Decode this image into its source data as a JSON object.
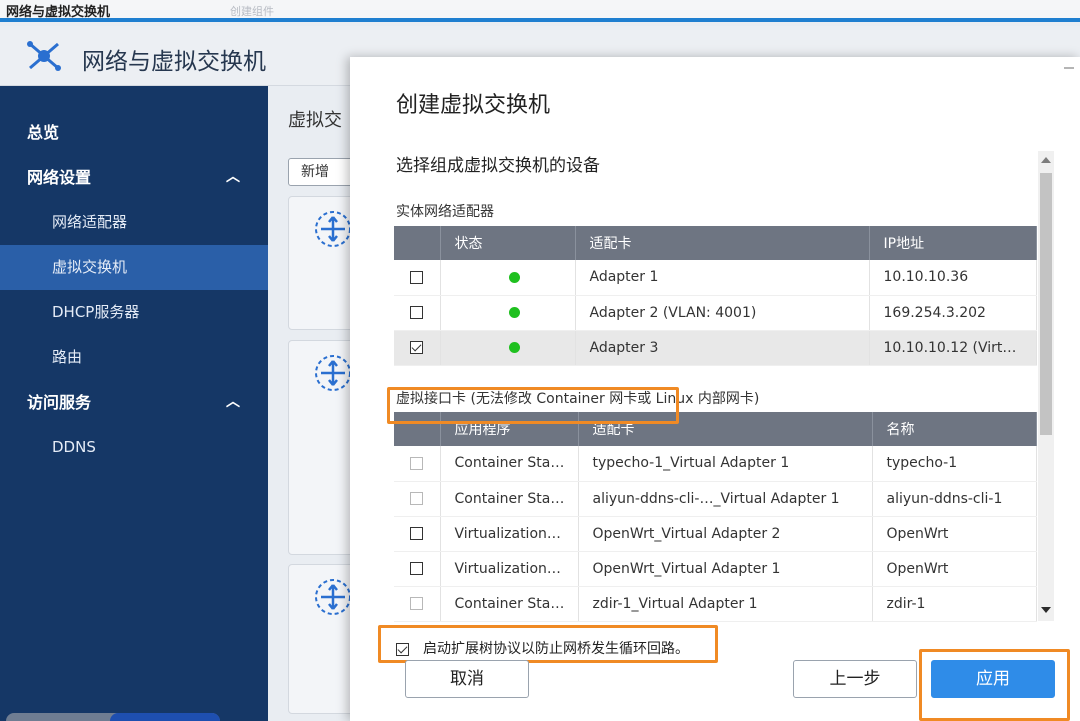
{
  "window": {
    "title": "网络与虚拟交换机",
    "faded_tab": "创建组件"
  },
  "app": {
    "title": "网络与虚拟交换机",
    "logo_icon": "network-switch-icon"
  },
  "sidebar": {
    "items": [
      {
        "label": "总览",
        "type": "top"
      },
      {
        "label": "网络设置",
        "type": "top",
        "chevron": "^"
      },
      {
        "label": "网络适配器",
        "type": "sub"
      },
      {
        "label": "虚拟交换机",
        "type": "sub",
        "active": true
      },
      {
        "label": "DHCP服务器",
        "type": "sub"
      },
      {
        "label": "路由",
        "type": "sub"
      },
      {
        "label": "访问服务",
        "type": "top",
        "chevron": "^"
      },
      {
        "label": "DDNS",
        "type": "sub"
      }
    ]
  },
  "main": {
    "heading": "虚拟交",
    "new_button": "新增"
  },
  "modal": {
    "title": "创建虚拟交换机",
    "section_title": "选择组成虚拟交换机的设备",
    "physical": {
      "label": "实体网络适配器",
      "headers": [
        "",
        "状态",
        "适配卡",
        "IP地址"
      ],
      "rows": [
        {
          "checked": false,
          "status": "green",
          "adapter": "Adapter 1",
          "ip": "10.10.10.36"
        },
        {
          "checked": false,
          "status": "green",
          "adapter": "Adapter 2 (VLAN: 4001)",
          "ip": "169.254.3.202"
        },
        {
          "checked": true,
          "status": "green",
          "adapter": "Adapter 3",
          "ip": "10.10.10.12 (Virt…"
        }
      ]
    },
    "virtual": {
      "label": "虚拟接口卡 (无法修改 Container 网卡或 Linux 内部网卡)",
      "headers": [
        "",
        "应用程序",
        "适配卡",
        "名称"
      ],
      "rows": [
        {
          "disabled": true,
          "app": "Container Sta…",
          "adapter": "typecho-1_Virtual Adapter 1",
          "name": "typecho-1"
        },
        {
          "disabled": true,
          "app": "Container Sta…",
          "adapter": "aliyun-ddns-cli-…_Virtual Adapter 1",
          "name": "aliyun-ddns-cli-1"
        },
        {
          "disabled": false,
          "app": "Virtualization…",
          "adapter": "OpenWrt_Virtual Adapter 2",
          "name": "OpenWrt"
        },
        {
          "disabled": false,
          "app": "Virtualization…",
          "adapter": "OpenWrt_Virtual Adapter 1",
          "name": "OpenWrt"
        },
        {
          "disabled": true,
          "app": "Container Sta…",
          "adapter": "zdir-1_Virtual Adapter 1",
          "name": "zdir-1"
        }
      ]
    },
    "stp": {
      "checked": true,
      "label": "启动扩展树协议以防止网桥发生循环回路。"
    },
    "buttons": {
      "cancel": "取消",
      "back": "上一步",
      "apply": "应用"
    }
  },
  "colors": {
    "sidebar": "#153766",
    "sidebar_active": "#2a5fa8",
    "accent": "#2f8ce8",
    "highlight": "#f08a24",
    "status_green": "#1fc01f"
  }
}
